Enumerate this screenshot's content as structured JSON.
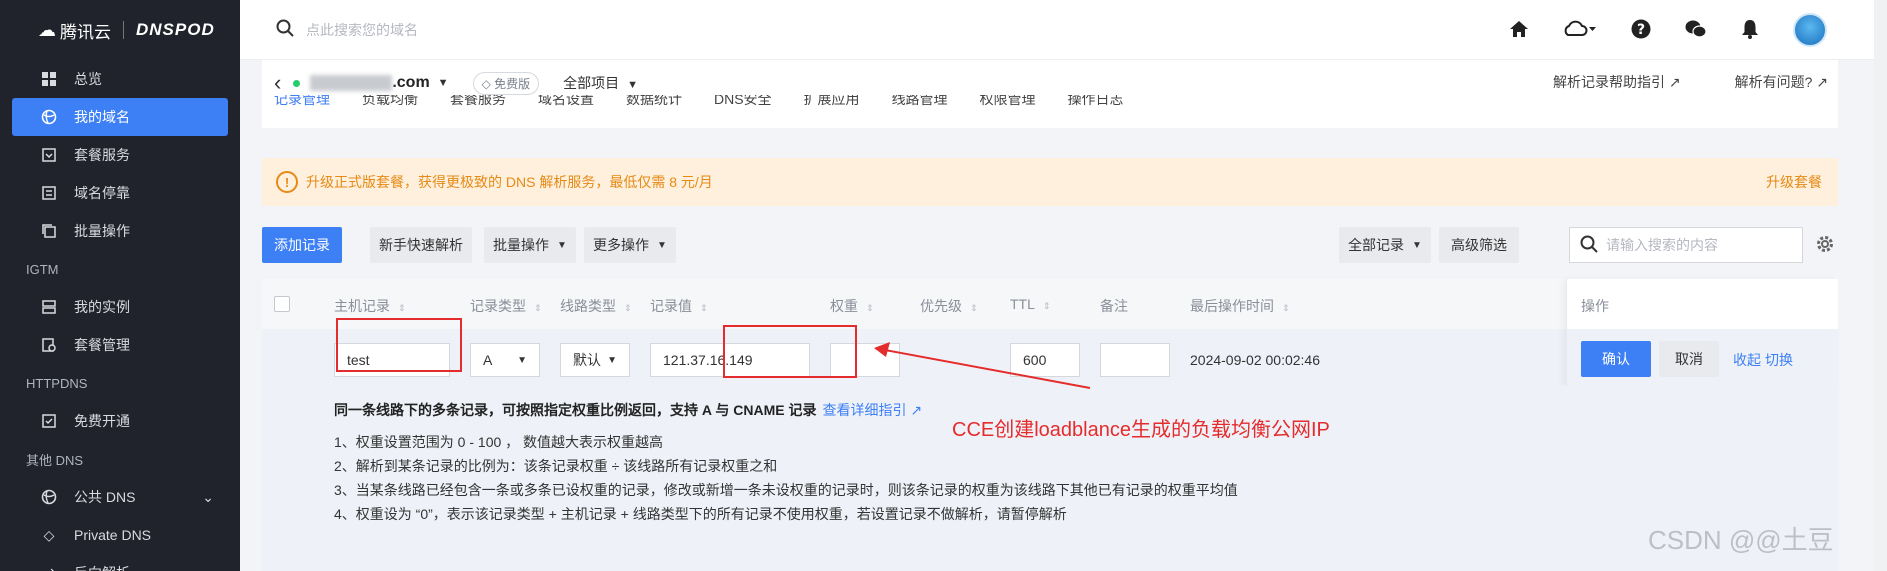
{
  "sidebar": {
    "logo_cloud": "腾讯云",
    "logo_product": "DNSPOD",
    "items": [
      {
        "label": "总览"
      },
      {
        "label": "我的域名"
      },
      {
        "label": "套餐服务"
      },
      {
        "label": "域名停靠"
      },
      {
        "label": "批量操作"
      }
    ],
    "group_igtm": "IGTM",
    "igtm_items": [
      {
        "label": "我的实例"
      },
      {
        "label": "套餐管理"
      }
    ],
    "group_httpdns": "HTTPDNS",
    "httpdns_items": [
      {
        "label": "免费开通"
      }
    ],
    "group_other": "其他 DNS",
    "other_items": [
      {
        "label": "公共 DNS"
      },
      {
        "label": "Private DNS"
      },
      {
        "label": "反向解析"
      }
    ]
  },
  "topbar": {
    "search_placeholder": "点此搜索您的域名"
  },
  "domain": {
    "name_suffix": ".com",
    "plan_badge": "免费版",
    "project": "全部项目",
    "help_link_1": "解析记录帮助指引",
    "help_link_2": "解析有问题?"
  },
  "tabs": [
    "记录管理",
    "负载均衡",
    "套餐服务",
    "域名设置",
    "数据统计",
    "DNS安全",
    "扩展应用",
    "线路管理",
    "权限管理",
    "操作日志"
  ],
  "notice": {
    "text": "升级正式版套餐，获得更极致的 DNS 解析服务，最低仅需 8 元/月",
    "action": "升级套餐"
  },
  "toolbar": {
    "add": "添加记录",
    "quick": "新手快速解析",
    "batch": "批量操作",
    "more": "更多操作",
    "all_records": "全部记录",
    "advanced": "高级筛选",
    "search_placeholder": "请输入搜索的内容"
  },
  "table": {
    "headers": {
      "host": "主机记录",
      "type": "记录类型",
      "line": "线路类型",
      "value": "记录值",
      "weight": "权重",
      "priority": "优先级",
      "ttl": "TTL",
      "remark": "备注",
      "last_op": "最后操作时间",
      "ops": "操作"
    },
    "row": {
      "host": "test",
      "type": "A",
      "line": "默认",
      "value": "121.37.16.149",
      "weight": "",
      "ttl": "600",
      "remark": "",
      "last_op": "2024-09-02 00:02:46",
      "confirm": "确认",
      "cancel": "取消",
      "collapse": "收起",
      "switch": "切换"
    }
  },
  "info": {
    "title": "同一条线路下的多条记录，可按照指定权重比例返回，支持 A 与 CNAME 记录",
    "link": "查看详细指引",
    "lines": [
      "1、权重设置范围为 0 - 100 ， 数值越大表示权重越高",
      "2、解析到某条记录的比例为：该条记录权重 ÷ 该线路所有记录权重之和",
      "3、当某条线路已经包含一条或多条已设权重的记录，修改或新增一条未设权重的记录时，则该条记录的权重为该线路下其他已有记录的权重平均值",
      "4、权重设为 “0”，表示该记录类型 + 主机记录 + 线路类型下的所有记录不使用权重，若设置记录不做解析，请暂停解析"
    ]
  },
  "annotation": {
    "label": "CCE创建loadblance生成的负载均衡公网IP",
    "color": "#e52c2c"
  },
  "watermark": "CSDN @@土豆",
  "colors": {
    "accent": "#3d7ff5",
    "sidebar_bg": "#20232b",
    "notice_bg": "#fef0dc",
    "notice_text": "#e68a16"
  }
}
